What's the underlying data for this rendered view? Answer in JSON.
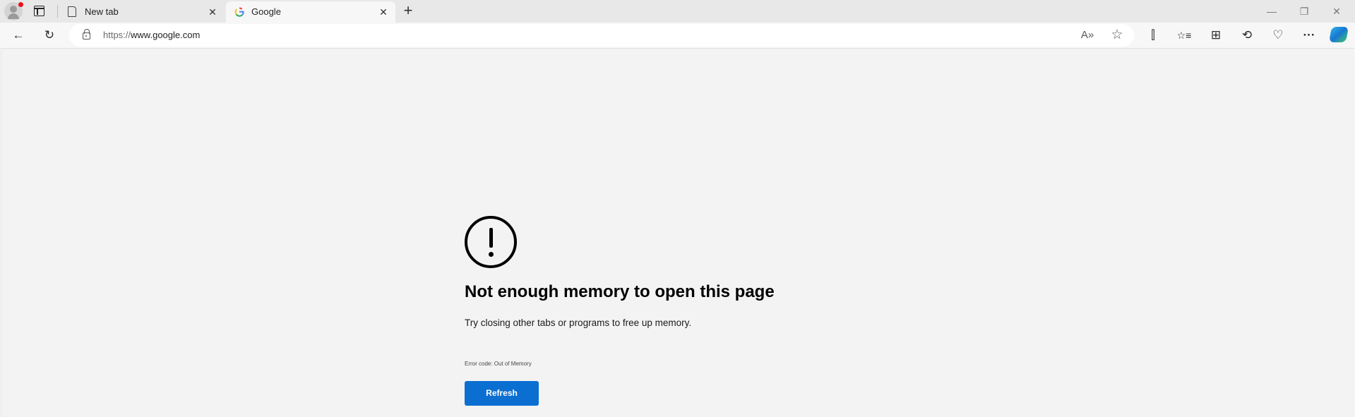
{
  "browser": {
    "tabs": [
      {
        "label": "New tab",
        "icon": "document-icon",
        "active": false
      },
      {
        "label": "Google",
        "icon": "google-g-icon",
        "active": true
      }
    ],
    "new_tab_glyph": "+",
    "tab_close_glyph": "✕",
    "window_controls": {
      "minimize": "—",
      "restore": "❐",
      "close": "✕"
    },
    "address": {
      "scheme": "https://",
      "host": "www.google.com"
    },
    "toolbar": {
      "back": "←",
      "refresh": "↻",
      "read_aloud": "A»",
      "favorite": "☆",
      "split_screen": "⫿",
      "favorites": "☆≡",
      "collections": "⊞",
      "history": "⟲",
      "browser_essentials": "♡",
      "more": "···"
    }
  },
  "error_page": {
    "heading": "Not enough memory to open this page",
    "message": "Try closing other tabs or programs to free up memory.",
    "error_code": "Error code: Out of Memory",
    "refresh_label": "Refresh",
    "accent_color": "#0b6fd1"
  }
}
